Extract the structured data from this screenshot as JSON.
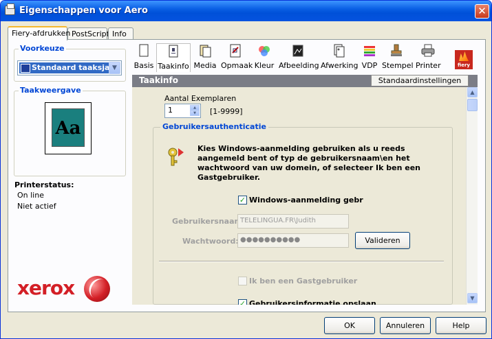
{
  "window": {
    "title": "Eigenschappen voor Aero",
    "close_label": "✕"
  },
  "tabs": [
    {
      "label": "Fiery-afdrukken",
      "active": true
    },
    {
      "label": "PostScript",
      "active": false
    },
    {
      "label": "Info",
      "active": false
    }
  ],
  "sidebar": {
    "preset_label": "Voorkeuze",
    "preset_value": "Standaard taaksjab",
    "preview_label": "Taakweergave",
    "preview_text": "Aa",
    "printer_status_label": "Printerstatus:",
    "printer_status_lines": [
      "On line",
      "Niet actief"
    ],
    "brand": "xerox"
  },
  "toolbar": {
    "items": [
      {
        "label": "Basis",
        "icon": "page-icon"
      },
      {
        "label": "Taakinfo",
        "icon": "job-info-icon",
        "selected": true
      },
      {
        "label": "Media",
        "icon": "media-icon"
      },
      {
        "label": "Opmaak",
        "icon": "layout-icon"
      },
      {
        "label": "Kleur",
        "icon": "color-icon"
      },
      {
        "label": "Afbeelding",
        "icon": "image-icon"
      },
      {
        "label": "Afwerking",
        "icon": "finishing-icon"
      },
      {
        "label": "VDP",
        "icon": "vdp-icon"
      },
      {
        "label": "Stempel",
        "icon": "stamp-icon"
      },
      {
        "label": "Printer",
        "icon": "printer-icon"
      }
    ],
    "logo_text": "fiery"
  },
  "section": {
    "title": "Taakinfo",
    "defaults_button": "Standaardinstellingen"
  },
  "copies": {
    "label": "Aantal Exemplaren",
    "value": "1",
    "range": "[1-9999]"
  },
  "auth": {
    "group_title": "Gebruikersauthenticatie",
    "description": "Kies Windows-aanmelding gebruiken als u reeds aangemeld bent of typ de gebruikersnaam\\en het wachtwoord van uw domein, of selecteer Ik ben een Gastgebruiker.",
    "windows_login_label": "Windows-aanmelding gebruiken",
    "windows_login_checked": true,
    "username_label": "Gebruikersnaam:",
    "username_value": "TELELINGUA.FR\\Judith",
    "password_label": "Wachtwoord:",
    "password_value": "●●●●●●●●●●",
    "validate_button": "Valideren",
    "guest_label": "Ik ben een Gastgebruiker",
    "guest_checked": false,
    "partial_label": "Gebruikersinformatie opslaan",
    "partial_checked": true
  },
  "footer": {
    "ok": "OK",
    "cancel": "Annuleren",
    "help": "Help"
  }
}
